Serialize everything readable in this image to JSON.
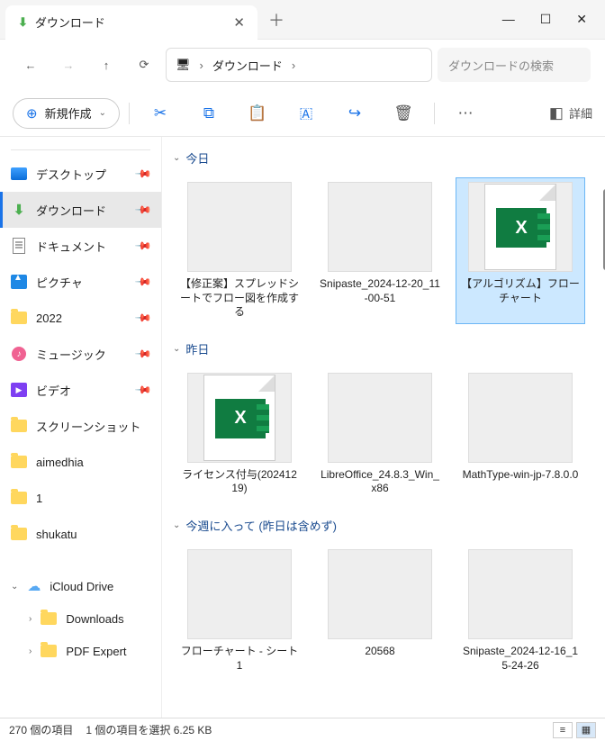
{
  "window": {
    "tab_title": "ダウンロード",
    "minimize": "―",
    "maximize": "☐",
    "close": "✕"
  },
  "address": {
    "location": "ダウンロード"
  },
  "search": {
    "placeholder": "ダウンロードの検索"
  },
  "toolbar": {
    "new": "新規作成",
    "details": "詳細"
  },
  "sidebar": {
    "pinned": [
      {
        "label": "デスクトップ",
        "icon": "desktop",
        "pinned": true
      },
      {
        "label": "ダウンロード",
        "icon": "download",
        "pinned": true,
        "active": true
      },
      {
        "label": "ドキュメント",
        "icon": "document",
        "pinned": true
      },
      {
        "label": "ピクチャ",
        "icon": "picture",
        "pinned": true
      },
      {
        "label": "2022",
        "icon": "folder",
        "pinned": true
      },
      {
        "label": "ミュージック",
        "icon": "music",
        "pinned": true
      },
      {
        "label": "ビデオ",
        "icon": "video",
        "pinned": true
      },
      {
        "label": "スクリーンショット",
        "icon": "folder"
      },
      {
        "label": "aimedhia",
        "icon": "folder"
      },
      {
        "label": "1",
        "icon": "folder"
      },
      {
        "label": "shukatu",
        "icon": "folder"
      }
    ],
    "cloud": {
      "label": "iCloud Drive",
      "children": [
        {
          "label": "Downloads"
        },
        {
          "label": "PDF Expert"
        }
      ]
    }
  },
  "groups": [
    {
      "label": "今日",
      "files": [
        {
          "name": "【修正案】スプレッドシートでフロー図を作成する",
          "icon": "word"
        },
        {
          "name": "Snipaste_2024-12-20_11-00-51",
          "icon": "image"
        },
        {
          "name": "【アルゴリズム】フローチャート",
          "icon": "excel",
          "selected": true
        }
      ]
    },
    {
      "label": "昨日",
      "files": [
        {
          "name": "ライセンス付与(20241219)",
          "icon": "excel"
        },
        {
          "name": "LibreOffice_24.8.3_Win_x86",
          "icon": "disc"
        },
        {
          "name": "MathType-win-jp-7.8.0.0",
          "icon": "installer"
        }
      ]
    },
    {
      "label": "今週に入って (昨日は含めず)",
      "files": [
        {
          "name": "フローチャート - シート1",
          "icon": "pdf"
        },
        {
          "name": "20568",
          "icon": "image"
        },
        {
          "name": "Snipaste_2024-12-16_15-24-26",
          "icon": "image"
        }
      ]
    }
  ],
  "status": {
    "count": "270 個の項目",
    "selection": "1 個の項目を選択 6.25 KB"
  }
}
